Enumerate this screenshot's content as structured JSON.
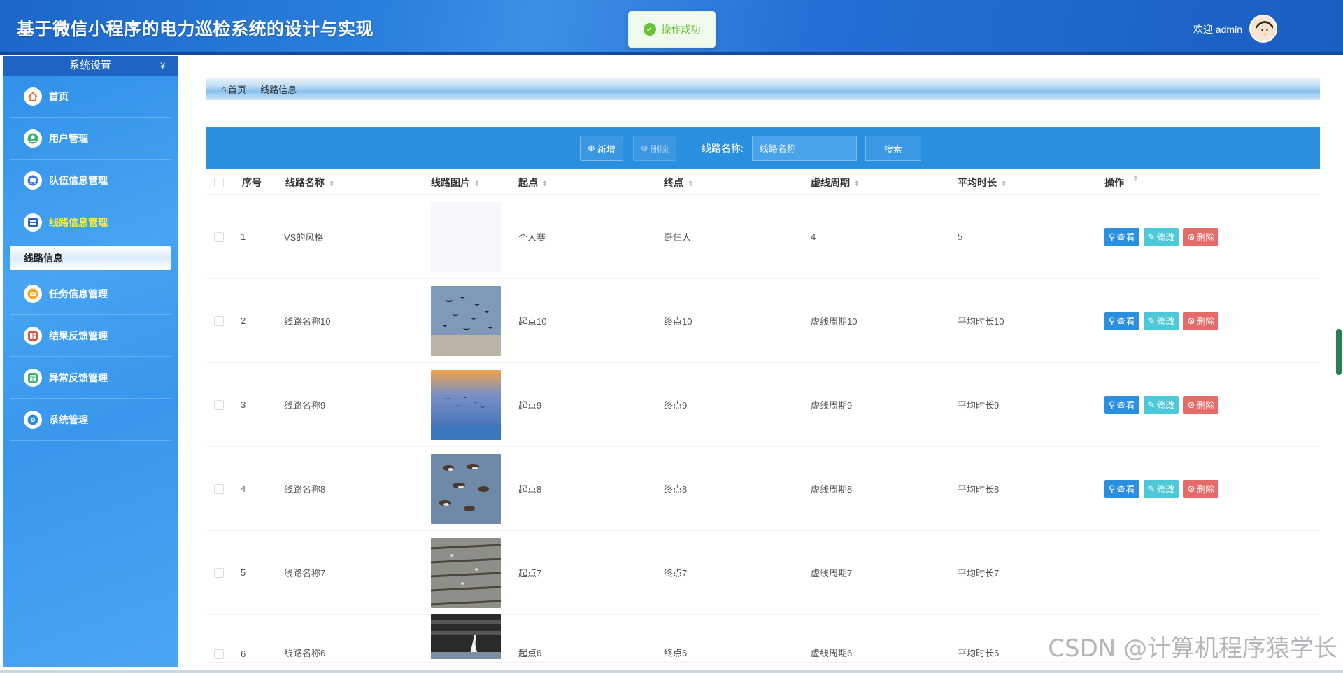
{
  "header": {
    "title": "基于微信小程序的电力巡检系统的设计与实现",
    "toast": "操作成功",
    "welcome": "欢迎 admin"
  },
  "sidebar": {
    "section_title": "系统设置",
    "items": [
      {
        "label": "首页",
        "icon": "home-icon"
      },
      {
        "label": "用户管理",
        "icon": "user-icon"
      },
      {
        "label": "队伍信息管理",
        "icon": "team-icon"
      },
      {
        "label": "线路信息管理",
        "icon": "route-icon"
      },
      {
        "label": "任务信息管理",
        "icon": "task-icon"
      },
      {
        "label": "结果反馈管理",
        "icon": "result-icon"
      },
      {
        "label": "异常反馈管理",
        "icon": "anomaly-icon"
      },
      {
        "label": "系统管理",
        "icon": "system-icon"
      }
    ],
    "active_submenu": "线路信息"
  },
  "breadcrumb": {
    "home": "首页",
    "sep": "-",
    "current": "线路信息"
  },
  "toolbar": {
    "add_label": "新增",
    "delete_label": "删除",
    "search_label": "线路名称:",
    "search_placeholder": "线路名称",
    "search_button": "搜索"
  },
  "table": {
    "columns": [
      "序号",
      "线路名称",
      "线路图片",
      "起点",
      "终点",
      "虚线周期",
      "平均时长",
      "操作"
    ],
    "rows": [
      {
        "idx": "1",
        "name": "VS的风格",
        "start": "个人赛",
        "end": "哥仨人",
        "cycle": "4",
        "duration": "5",
        "has_ops": true
      },
      {
        "idx": "2",
        "name": "线路名称10",
        "start": "起点10",
        "end": "终点10",
        "cycle": "虚线周期10",
        "duration": "平均时长10",
        "has_ops": true
      },
      {
        "idx": "3",
        "name": "线路名称9",
        "start": "起点9",
        "end": "终点9",
        "cycle": "虚线周期9",
        "duration": "平均时长9",
        "has_ops": true
      },
      {
        "idx": "4",
        "name": "线路名称8",
        "start": "起点8",
        "end": "终点8",
        "cycle": "虚线周期8",
        "duration": "平均时长8",
        "has_ops": true
      },
      {
        "idx": "5",
        "name": "线路名称7",
        "start": "起点7",
        "end": "终点7",
        "cycle": "虚线周期7",
        "duration": "平均时长7",
        "has_ops": false
      },
      {
        "idx": "6",
        "name": "线路名称6",
        "start": "起点6",
        "end": "终点6",
        "cycle": "虚线周期6",
        "duration": "平均时长6",
        "has_ops": false
      }
    ],
    "ops": {
      "view": "查看",
      "edit": "修改",
      "delete": "删除"
    }
  },
  "watermark": "CSDN @计算机程序猿学长",
  "colors": {
    "header": "#1c66c9",
    "sidebar": "#3896ec",
    "toolbar": "#2b8fe0",
    "view_button": "#2b8fe0",
    "edit_button": "#4cc8d6",
    "delete_button": "#e56b6b",
    "active_menu_text": "#ffeb3b",
    "toast_success": "#67c23a"
  }
}
